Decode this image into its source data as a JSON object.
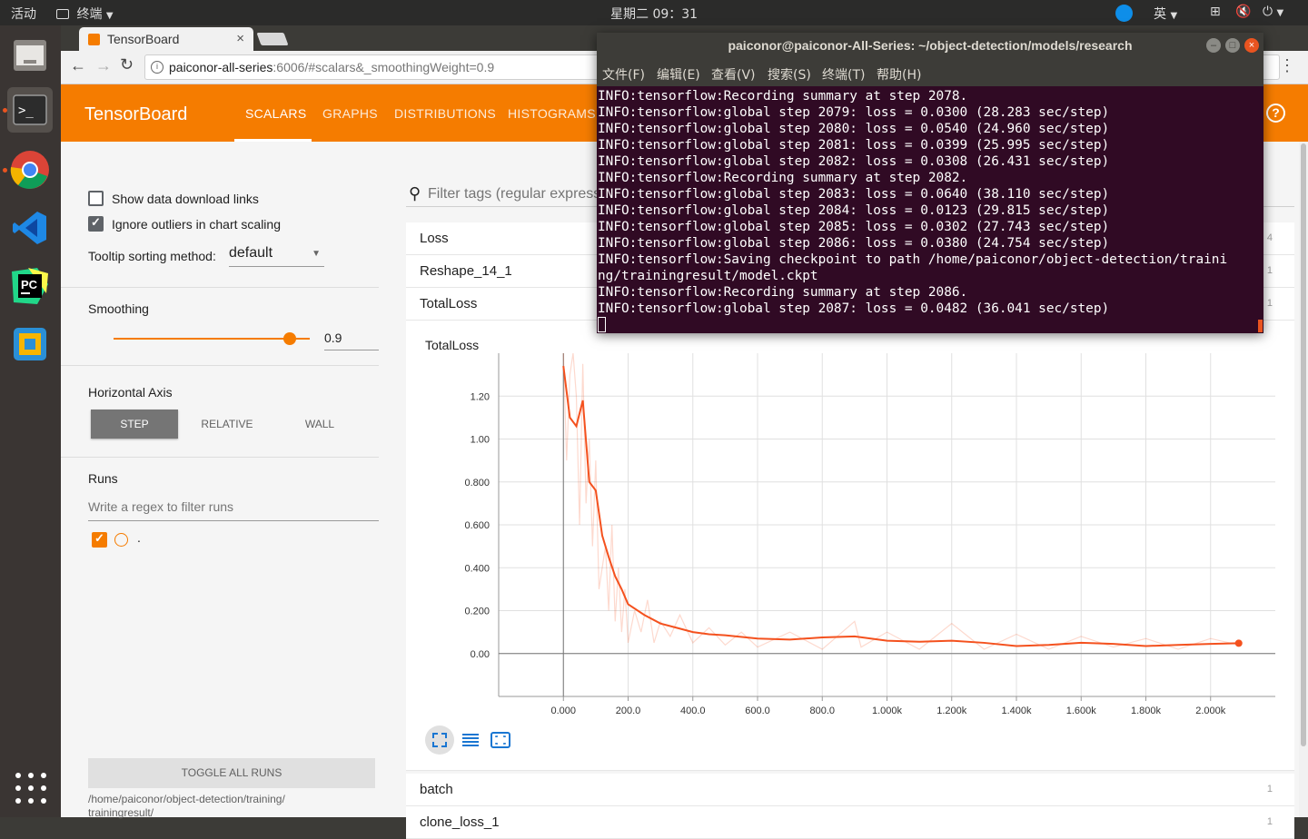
{
  "topbar": {
    "activities": "活动",
    "app_menu": "终端",
    "clock": "星期二 09：31",
    "input_method": "英"
  },
  "chrome": {
    "tab_title": "TensorBoard",
    "url_host": "paiconor-all-series",
    "url_rest": ":6006/#scalars&_smoothingWeight=0.9"
  },
  "tensorboard": {
    "logo": "TensorBoard",
    "nav": [
      "SCALARS",
      "GRAPHS",
      "DISTRIBUTIONS",
      "HISTOGRAMS"
    ],
    "help": "?",
    "sidebar": {
      "show_download_links": "Show data download links",
      "ignore_outliers": "Ignore outliers in chart scaling",
      "tooltip_label": "Tooltip sorting method:",
      "tooltip_value": "default",
      "smoothing_title": "Smoothing",
      "smoothing_value": "0.9",
      "smoothing_level": 0.9,
      "haxis_title": "Horizontal Axis",
      "haxis_options": [
        "STEP",
        "RELATIVE",
        "WALL"
      ],
      "runs_title": "Runs",
      "runs_filter_placeholder": "Write a regex to filter runs",
      "run_name": ".",
      "toggle_all": "TOGGLE ALL RUNS",
      "logdir": "/home/paiconor/object-detection/training/\ntrainingresult/"
    },
    "filter_placeholder": "Filter tags (regular expressions supported)",
    "tag_groups": [
      {
        "name": "Loss",
        "count": "4"
      },
      {
        "name": "Reshape_14_1",
        "count": "1"
      },
      {
        "name": "TotalLoss",
        "count": "1"
      },
      {
        "name": "batch",
        "count": "1"
      },
      {
        "name": "clone_loss_1",
        "count": "1"
      }
    ]
  },
  "chart_data": {
    "type": "line",
    "title": "TotalLoss",
    "xlabel": "",
    "ylabel": "",
    "x_ticks": [
      "0.000",
      "200.0",
      "400.0",
      "600.0",
      "800.0",
      "1.000k",
      "1.200k",
      "1.400k",
      "1.600k",
      "1.800k",
      "2.000k"
    ],
    "y_ticks": [
      "0.00",
      "0.200",
      "0.400",
      "0.600",
      "0.800",
      "1.00",
      "1.20"
    ],
    "xlim": [
      -200,
      2200
    ],
    "ylim": [
      -0.2,
      1.4
    ],
    "series": [
      {
        "name": "smoothed",
        "color": "#f4511e",
        "x": [
          0,
          20,
          40,
          60,
          80,
          100,
          120,
          140,
          160,
          180,
          200,
          250,
          300,
          350,
          400,
          450,
          500,
          600,
          700,
          800,
          900,
          950,
          1000,
          1100,
          1200,
          1300,
          1400,
          1500,
          1600,
          1700,
          1800,
          1900,
          2000,
          2087
        ],
        "y": [
          1.34,
          1.1,
          1.06,
          1.18,
          0.8,
          0.76,
          0.55,
          0.45,
          0.36,
          0.3,
          0.23,
          0.18,
          0.14,
          0.12,
          0.1,
          0.09,
          0.085,
          0.07,
          0.065,
          0.075,
          0.08,
          0.07,
          0.06,
          0.055,
          0.06,
          0.05,
          0.035,
          0.04,
          0.05,
          0.045,
          0.035,
          0.04,
          0.045,
          0.0482
        ]
      },
      {
        "name": "raw",
        "color": "#f4511e",
        "x": [
          0,
          10,
          20,
          30,
          40,
          50,
          60,
          70,
          80,
          90,
          100,
          110,
          120,
          130,
          140,
          150,
          160,
          170,
          180,
          190,
          200,
          220,
          240,
          260,
          280,
          300,
          330,
          360,
          400,
          450,
          500,
          550,
          600,
          700,
          800,
          900,
          920,
          1000,
          1100,
          1200,
          1300,
          1400,
          1500,
          1600,
          1700,
          1800,
          1900,
          2000,
          2087
        ],
        "y": [
          1.4,
          0.9,
          1.3,
          1.4,
          1.2,
          0.6,
          1.35,
          0.7,
          1.0,
          0.5,
          0.9,
          0.3,
          0.4,
          0.5,
          0.2,
          0.6,
          0.15,
          0.4,
          0.1,
          0.3,
          0.05,
          0.2,
          0.1,
          0.25,
          0.05,
          0.15,
          0.08,
          0.18,
          0.05,
          0.12,
          0.04,
          0.1,
          0.03,
          0.1,
          0.02,
          0.15,
          0.03,
          0.1,
          0.02,
          0.14,
          0.02,
          0.09,
          0.02,
          0.08,
          0.03,
          0.07,
          0.02,
          0.07,
          0.04
        ]
      }
    ]
  },
  "terminal": {
    "title": "paiconor@paiconor-All-Series: ~/object-detection/models/research",
    "menu": [
      "文件(F)",
      "编辑(E)",
      "查看(V)",
      "搜索(S)",
      "终端(T)",
      "帮助(H)"
    ],
    "lines": [
      "INFO:tensorflow:Recording summary at step 2078.",
      "INFO:tensorflow:global step 2079: loss = 0.0300 (28.283 sec/step)",
      "INFO:tensorflow:global step 2080: loss = 0.0540 (24.960 sec/step)",
      "INFO:tensorflow:global step 2081: loss = 0.0399 (25.995 sec/step)",
      "INFO:tensorflow:global step 2082: loss = 0.0308 (26.431 sec/step)",
      "INFO:tensorflow:Recording summary at step 2082.",
      "INFO:tensorflow:global step 2083: loss = 0.0640 (38.110 sec/step)",
      "INFO:tensorflow:global step 2084: loss = 0.0123 (29.815 sec/step)",
      "INFO:tensorflow:global step 2085: loss = 0.0302 (27.743 sec/step)",
      "INFO:tensorflow:global step 2086: loss = 0.0380 (24.754 sec/step)",
      "INFO:tensorflow:Saving checkpoint to path /home/paiconor/object-detection/traini",
      "ng/trainingresult/model.ckpt",
      "INFO:tensorflow:Recording summary at step 2086.",
      "INFO:tensorflow:global step 2087: loss = 0.0482 (36.041 sec/step)"
    ]
  }
}
